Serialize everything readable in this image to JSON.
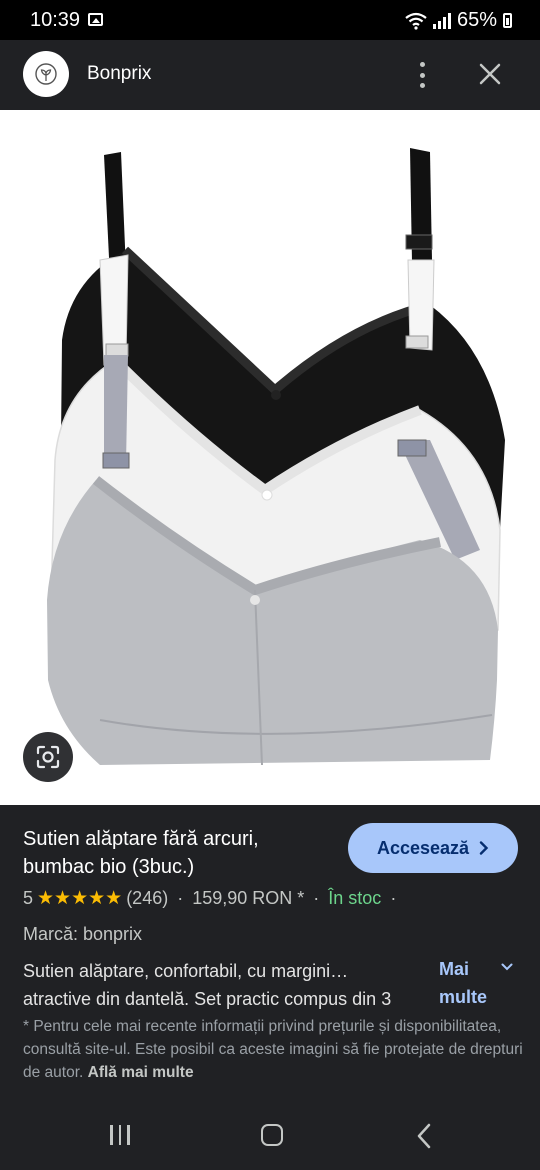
{
  "status_bar": {
    "time": "10:39",
    "battery": "65%"
  },
  "app_bar": {
    "title": "Bonprix"
  },
  "product": {
    "title": "Sutien alăptare fără arcuri, bumbac bio (3buc.)",
    "visit_button": "Accesează",
    "rating_value": "5",
    "stars": "★★★★★",
    "review_count": "(246)",
    "price": "159,90 RON *",
    "availability": "În stoc",
    "separator": "·",
    "brand": "Marcă: bonprix",
    "description_line1": "Sutien alăptare, confortabil, cu margini…",
    "description_line2": "atractive din dantelă. Set practic compus din 3",
    "more_label": "Mai multe",
    "disclaimer": "* Pentru cele mai recente informații privind prețurile și disponibilitatea, consultă site-ul. Este posibil ca aceste imagini să fie protejate de drepturi de autor.",
    "learn_more": "Află mai multe"
  },
  "colors": {
    "accent_button": "#a8c7fa",
    "in_stock": "#6dd58c",
    "star": "#fbbc04",
    "panel_bg": "#202124"
  },
  "icons": [
    "picture-icon",
    "wifi-icon",
    "signal-icon",
    "battery-icon",
    "bonprix-logo-icon",
    "more-vert-icon",
    "close-icon",
    "google-lens-icon",
    "chevron-right-icon",
    "chevron-down-icon",
    "nav-recents-icon",
    "nav-home-icon",
    "nav-back-icon"
  ]
}
